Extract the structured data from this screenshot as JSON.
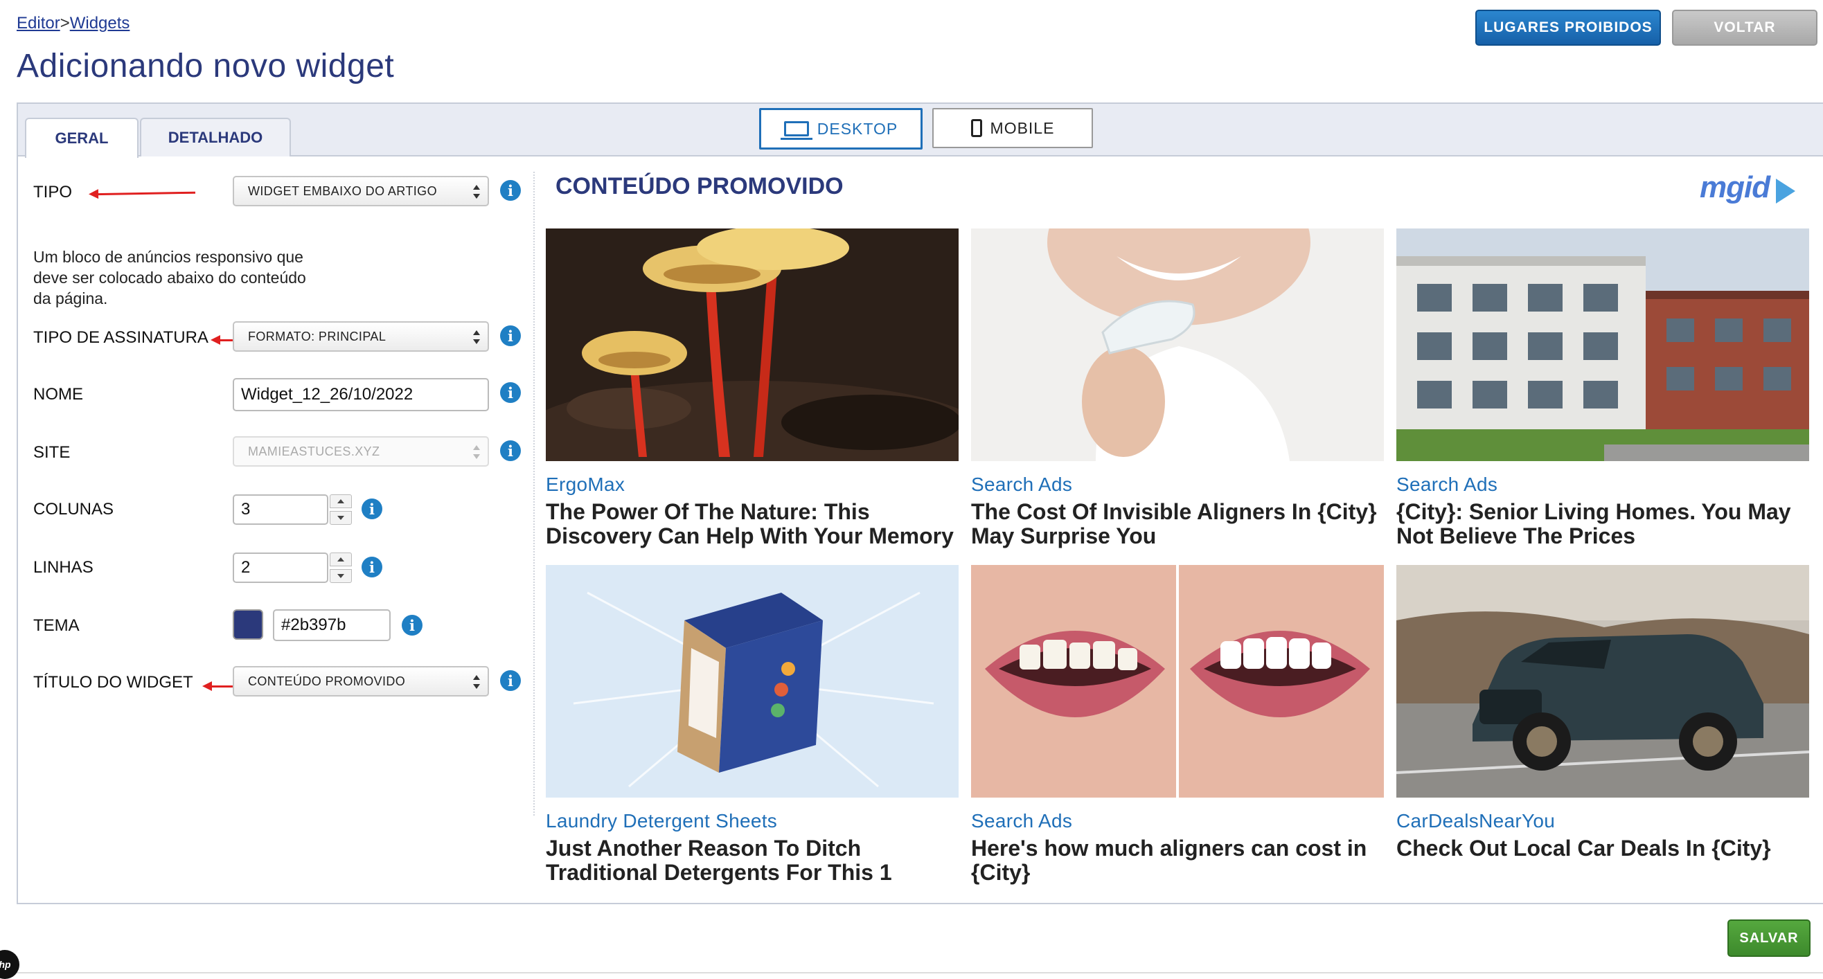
{
  "breadcrumb": {
    "editor": "Editor",
    "separator": ">",
    "widgets": "Widgets"
  },
  "page_title": "Adicionando novo widget",
  "top_buttons": {
    "lugares": "LUGARES PROIBIDOS",
    "voltar": "VOLTAR"
  },
  "tabs": {
    "geral": "GERAL",
    "detalhado": "DETALHADO"
  },
  "devices": {
    "desktop": "DESKTOP",
    "mobile": "MOBILE"
  },
  "form": {
    "tipo_label": "TIPO",
    "tipo_value": "WIDGET EMBAIXO DO ARTIGO",
    "description": "Um bloco de anúncios responsivo que deve ser colocado abaixo do conteúdo da página.",
    "assinatura_label": "TIPO DE ASSINATURA",
    "assinatura_value": "FORMATO: PRINCIPAL",
    "nome_label": "NOME",
    "nome_value": "Widget_12_26/10/2022",
    "site_label": "SITE",
    "site_value": "MAMIEASTUCES.XYZ",
    "colunas_label": "COLUNAS",
    "colunas_value": "3",
    "linhas_label": "LINHAS",
    "linhas_value": "2",
    "tema_label": "TEMA",
    "tema_value": "#2b397b",
    "titulo_label": "TÍTULO DO WIDGET",
    "titulo_value": "CONTEÚDO PROMOVIDO",
    "info_glyph": "i"
  },
  "preview": {
    "title": "CONTEÚDO PROMOVIDO",
    "logo": "mgid",
    "cards": [
      {
        "source": "ErgoMax",
        "title": "The Power Of The Nature: This Discovery Can Help With Your Memory",
        "image": "mushroom-photo"
      },
      {
        "source": "Search Ads",
        "title": "The Cost Of Invisible Aligners In {City} May Surprise You",
        "image": "aligner-smile-photo"
      },
      {
        "source": "Search Ads",
        "title": "{City}: Senior Living Homes. You May Not Believe The Prices",
        "image": "apartment-building-photo"
      },
      {
        "source": "Laundry Detergent Sheets",
        "title": "Just Another Reason To Ditch Traditional Detergents For This 1",
        "image": "detergent-box-photo"
      },
      {
        "source": "Search Ads",
        "title": "Here's how much aligners can cost in {City}",
        "image": "teeth-before-after-photo"
      },
      {
        "source": "CarDealsNearYou",
        "title": "Check Out Local Car Deals In {City}",
        "image": "suv-photo"
      }
    ]
  },
  "salvar": "SALVAR",
  "corner_badge": "hp",
  "colors": {
    "theme": "#2b397b",
    "accent_blue": "#1f6fb8",
    "save_green": "#3d8a2c",
    "annotation_red": "#e02020"
  }
}
